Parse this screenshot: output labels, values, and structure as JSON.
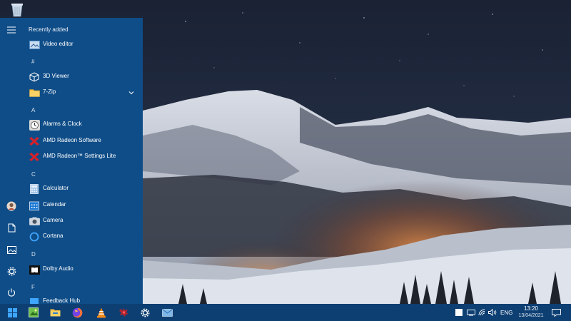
{
  "start_menu": {
    "section_title": "Recently added",
    "recent": [
      {
        "label": "Video editor",
        "icon": "video-editor-icon"
      }
    ],
    "groups": [
      {
        "letter": "#",
        "items": [
          {
            "label": "3D Viewer",
            "icon": "3d-viewer-icon"
          },
          {
            "label": "7-Zip",
            "icon": "folder-icon",
            "expandable": true
          }
        ]
      },
      {
        "letter": "A",
        "items": [
          {
            "label": "Alarms & Clock",
            "icon": "clock-icon"
          },
          {
            "label": "AMD Radeon Software",
            "icon": "amd-radeon-icon"
          },
          {
            "label": "AMD Radeon™ Settings Lite",
            "icon": "amd-radeon-icon"
          }
        ]
      },
      {
        "letter": "C",
        "items": [
          {
            "label": "Calculator",
            "icon": "calculator-icon"
          },
          {
            "label": "Calendar",
            "icon": "calendar-icon"
          },
          {
            "label": "Camera",
            "icon": "camera-icon"
          },
          {
            "label": "Cortana",
            "icon": "cortana-icon"
          }
        ]
      },
      {
        "letter": "D",
        "items": [
          {
            "label": "Dolby Audio",
            "icon": "dolby-audio-icon"
          }
        ]
      },
      {
        "letter": "F",
        "items": [
          {
            "label": "Feedback Hub",
            "icon": "feedback-hub-icon"
          }
        ]
      }
    ],
    "rail": [
      "hamburger-menu-icon",
      "user-avatar-icon",
      "documents-icon",
      "pictures-icon",
      "settings-gear-icon",
      "power-icon"
    ]
  },
  "taskbar": {
    "pinned": [
      "start-windows-icon",
      "photo-app-icon",
      "file-explorer-icon",
      "firefox-icon",
      "vlc-icon",
      "game-app-icon",
      "settings-gear-icon",
      "mail-icon"
    ],
    "tray": {
      "language": "ENG",
      "time": "13:20",
      "date": "13/04/2021"
    }
  },
  "colors": {
    "start_menu_bg": "#0f4d88",
    "taskbar_bg": "#0d3f73",
    "accent": "#1a78d4"
  }
}
